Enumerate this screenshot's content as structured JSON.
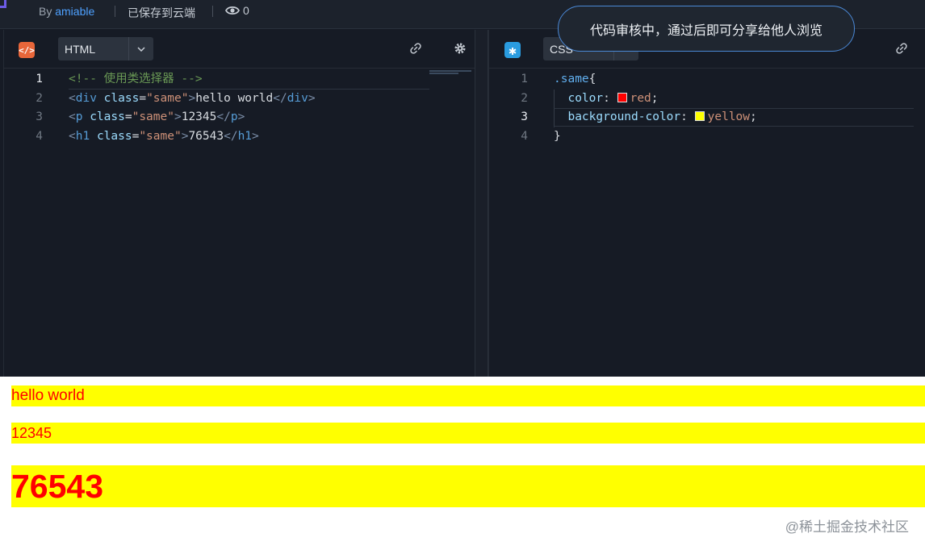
{
  "topbar": {
    "by_label": "By",
    "author": "amiable",
    "saved_status": "已保存到云端",
    "view_count": "0"
  },
  "toast": {
    "message": "代码审核中，通过后即可分享给他人浏览"
  },
  "html_pane": {
    "language": "HTML",
    "icons": [
      "html-code-icon",
      "chevron-down-icon",
      "link-icon",
      "gear-icon"
    ],
    "lines": [
      {
        "n": "1",
        "comment": "<!-- 使用类选择器 -->"
      },
      {
        "n": "2",
        "open_lt": "<",
        "tag": "div",
        "attr": "class",
        "eq": "=",
        "val": "\"same\"",
        "gt": ">",
        "text": "hello world",
        "close": "</",
        "close_tag": "div",
        "close_gt": ">"
      },
      {
        "n": "3",
        "open_lt": "<",
        "tag": "p",
        "attr": "class",
        "eq": "=",
        "val": "\"same\"",
        "gt": ">",
        "text": "12345",
        "close": "</",
        "close_tag": "p",
        "close_gt": ">"
      },
      {
        "n": "4",
        "open_lt": "<",
        "tag": "h1",
        "attr": "class",
        "eq": "=",
        "val": "\"same\"",
        "gt": ">",
        "text": "76543",
        "close": "</",
        "close_tag": "h1",
        "close_gt": ">"
      }
    ]
  },
  "css_pane": {
    "language": "CSS",
    "icons": [
      "css-asterisk-icon",
      "chevron-down-icon",
      "link-icon"
    ],
    "lines": [
      {
        "n": "1",
        "selector": ".same",
        "brace": "{"
      },
      {
        "n": "2",
        "prop": "color",
        "colon": ":",
        "value": "red",
        "semi": ";",
        "swatch": "#ff0000"
      },
      {
        "n": "3",
        "prop": "background-color",
        "colon": ":",
        "value": "yellow",
        "semi": ";",
        "swatch": "#ffff00"
      },
      {
        "n": "4",
        "brace": "}"
      }
    ]
  },
  "preview": {
    "div_text": "hello world",
    "p_text": "12345",
    "h1_text": "76543",
    "text_color": "#ff0000",
    "background_color": "#ffff00"
  },
  "watermark": "@稀土掘金技术社区"
}
